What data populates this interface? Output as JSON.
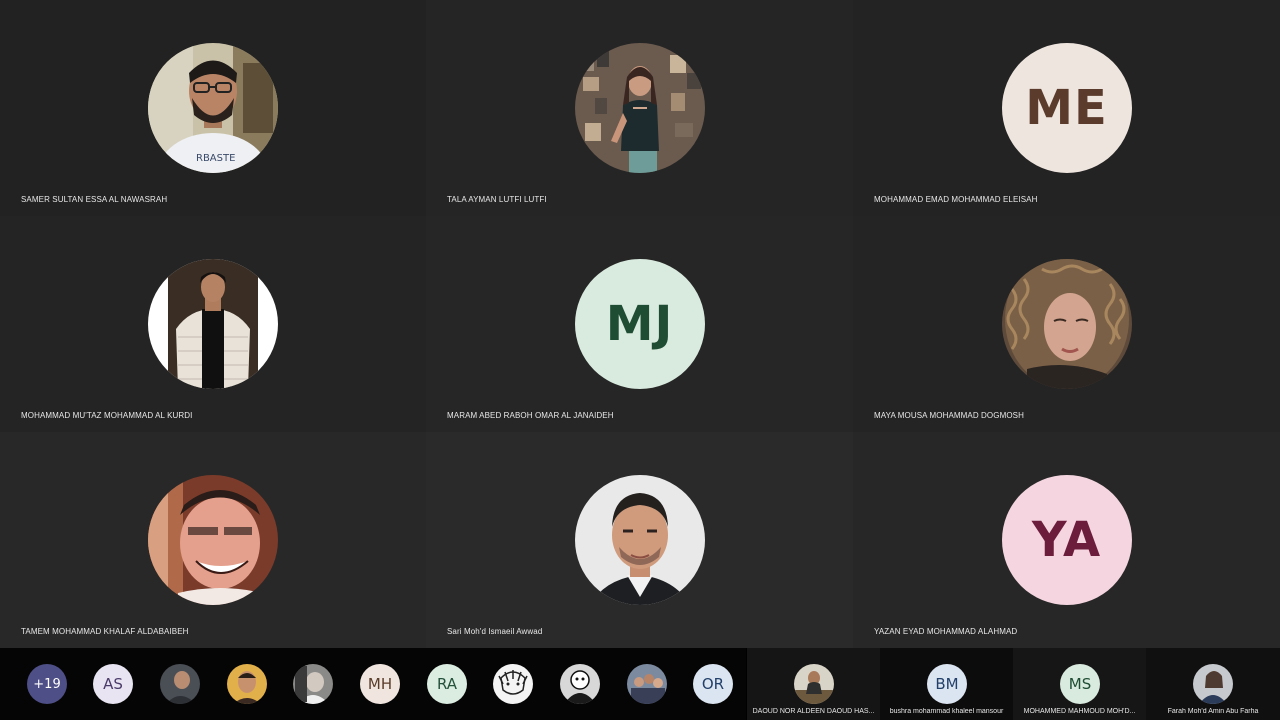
{
  "participants": [
    {
      "name": "SAMER SULTAN ESSA AL NAWASRAH",
      "photo": "man-with-glasses-photo"
    },
    {
      "name": "TALA AYMAN LUTFI LUTFI",
      "photo": "woman-standing-photo"
    },
    {
      "name": "MOHAMMAD EMAD MOHAMMAD ELEISAH",
      "initials": "ME",
      "bg": "#efe5df",
      "fg": "#5b3b2c"
    },
    {
      "name": "MOHAMMAD MU'TAZ MOHAMMAD AL KURDI",
      "photo": "man-white-jacket-photo"
    },
    {
      "name": "MARAM ABED RABOH OMAR AL JANAIDEH",
      "initials": "MJ",
      "bg": "#d9eade",
      "fg": "#1f4d33"
    },
    {
      "name": "MAYA MOUSA MOHAMMAD DOGMOSH",
      "photo": "woman-curly-hair-photo"
    },
    {
      "name": "TAMEM MOHAMMAD KHALAF ALDABAIBEH",
      "photo": "distorted-face-photo"
    },
    {
      "name": "Sari Moh'd Ismaeil Awwad",
      "photo": "man-portrait-photo"
    },
    {
      "name": "YAZAN EYAD MOHAMMAD ALAHMAD",
      "initials": "YA",
      "bg": "#f4d5e0",
      "fg": "#6c1d3b"
    }
  ],
  "strip": {
    "overflow_count": "+19",
    "items": [
      {
        "initials": "AS",
        "bg": "#e9e4f1",
        "fg": "#4b3b6b"
      },
      {
        "photo": "person-photo-1"
      },
      {
        "photo": "person-photo-2"
      },
      {
        "photo": "person-photo-3"
      },
      {
        "initials": "MH",
        "bg": "#f1e6df",
        "fg": "#5a3c2a"
      },
      {
        "initials": "RA",
        "bg": "#dbece1",
        "fg": "#24523a"
      },
      {
        "photo": "anime-sketch-photo"
      },
      {
        "photo": "cartoon-photo"
      },
      {
        "photo": "group-photo"
      },
      {
        "initials": "OR",
        "bg": "#dbe5f1",
        "fg": "#23406a"
      }
    ]
  },
  "featured": [
    {
      "name": "DAOUD NOR ALDEEN DAOUD HAS...",
      "photo": "man-sitting-photo"
    },
    {
      "name": "bushra mohammad khaleel mansour",
      "initials": "BM",
      "bg": "#dbe4f1",
      "fg": "#23406a"
    },
    {
      "name": "MOHAMMED MAHMOUD MOH'D...",
      "initials": "MS",
      "bg": "#d9eade",
      "fg": "#1f4d33"
    },
    {
      "name": "Farah Moh'd Amin Abu Farha",
      "photo": "woman-photo"
    }
  ],
  "colors": {
    "background": "#1f1f1f",
    "bottom_bar": "#000000",
    "overflow_badge": "#4f4f87"
  }
}
